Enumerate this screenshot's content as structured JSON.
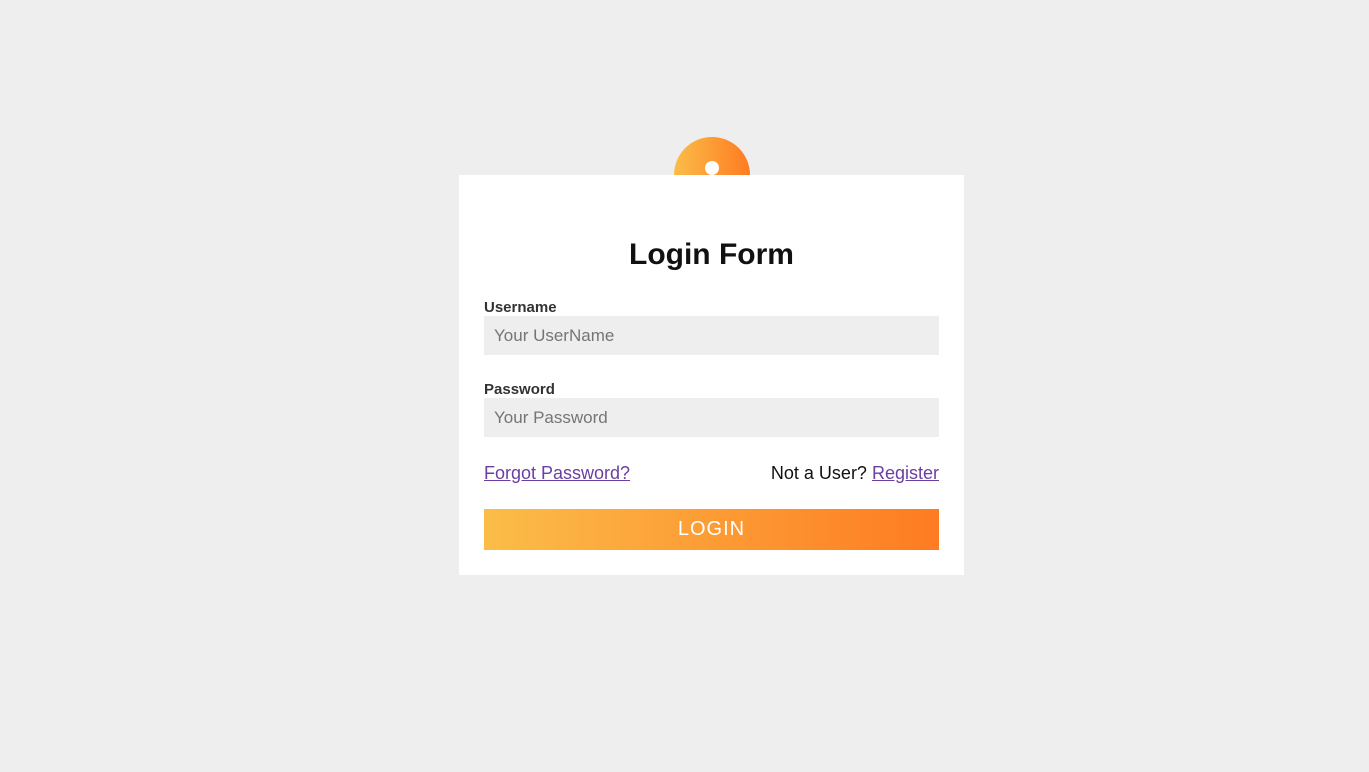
{
  "form": {
    "title": "Login Form",
    "username_label": "Username",
    "username_placeholder": "Your UserName",
    "password_label": "Password",
    "password_placeholder": "Your Password",
    "forgot_link": "Forgot Password?",
    "not_user_text": "Not a User?",
    "register_link": "Register",
    "login_button": "LOGIN"
  },
  "icons": {
    "avatar": "user-icon"
  },
  "colors": {
    "background": "#eeeeee",
    "gradient_start": "#fbbd48",
    "gradient_end": "#fe7b22",
    "link": "#6b3fa0"
  }
}
